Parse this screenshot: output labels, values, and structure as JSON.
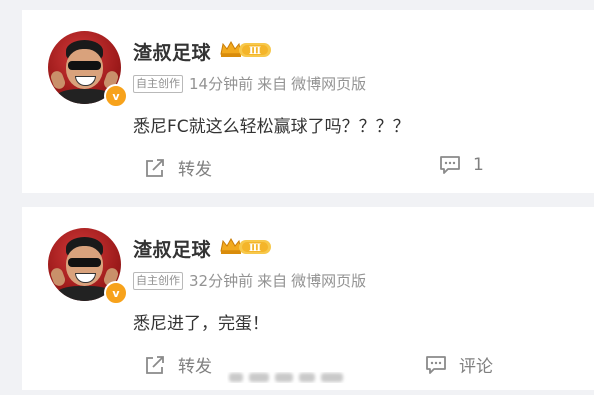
{
  "posts": [
    {
      "username": "渣叔足球",
      "level_badge": "Ⅲ",
      "verified_mark": "v",
      "original_tag": "自主创作",
      "time": "14分钟前",
      "source_prefix": "来自",
      "source": "微博网页版",
      "content": "悉尼FC就这么轻松赢球了吗？？？？",
      "share_label": "转发",
      "comment_label": "1"
    },
    {
      "username": "渣叔足球",
      "level_badge": "Ⅲ",
      "verified_mark": "v",
      "original_tag": "自主创作",
      "time": "32分钟前",
      "source_prefix": "来自",
      "source": "微博网页版",
      "content": "悉尼进了，完蛋！",
      "share_label": "转发",
      "comment_label": "评论"
    }
  ],
  "icons": {
    "share": "share-icon",
    "comment": "comment-icon",
    "crown": "crown-icon"
  },
  "colors": {
    "background": "#f1f2f5",
    "card": "#ffffff",
    "username": "#333333",
    "meta": "#939393",
    "badge_gold": "#f7b325",
    "verified_orange": "#f7a21b"
  }
}
